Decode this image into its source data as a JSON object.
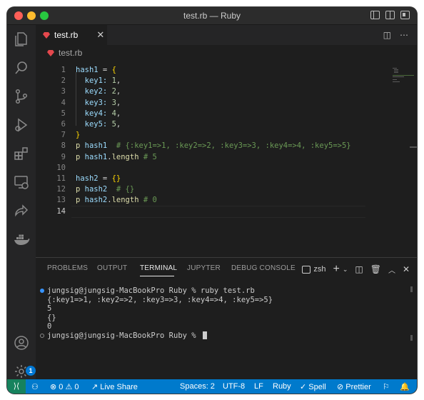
{
  "window": {
    "title": "test.rb — Ruby"
  },
  "tab": {
    "label": "test.rb"
  },
  "breadcrumb": {
    "label": "test.rb"
  },
  "editor": {
    "line_numbers": [
      "1",
      "2",
      "3",
      "4",
      "5",
      "6",
      "7",
      "8",
      "9",
      "10",
      "11",
      "12",
      "13",
      "14"
    ],
    "lines": [
      [
        {
          "t": "hash1",
          "c": "var"
        },
        {
          "t": " = ",
          "c": "plain"
        },
        {
          "t": "{",
          "c": "brace"
        }
      ],
      [
        {
          "t": "  key1:",
          "c": "sym"
        },
        {
          "t": " ",
          "c": "plain"
        },
        {
          "t": "1",
          "c": "num"
        },
        {
          "t": ",",
          "c": "plain"
        }
      ],
      [
        {
          "t": "  key2:",
          "c": "sym"
        },
        {
          "t": " ",
          "c": "plain"
        },
        {
          "t": "2",
          "c": "num"
        },
        {
          "t": ",",
          "c": "plain"
        }
      ],
      [
        {
          "t": "  key3:",
          "c": "sym"
        },
        {
          "t": " ",
          "c": "plain"
        },
        {
          "t": "3",
          "c": "num"
        },
        {
          "t": ",",
          "c": "plain"
        }
      ],
      [
        {
          "t": "  key4:",
          "c": "sym"
        },
        {
          "t": " ",
          "c": "plain"
        },
        {
          "t": "4",
          "c": "num"
        },
        {
          "t": ",",
          "c": "plain"
        }
      ],
      [
        {
          "t": "  key5:",
          "c": "sym"
        },
        {
          "t": " ",
          "c": "plain"
        },
        {
          "t": "5",
          "c": "num"
        },
        {
          "t": ",",
          "c": "plain"
        }
      ],
      [
        {
          "t": "}",
          "c": "brace"
        }
      ],
      [
        {
          "t": "p",
          "c": "kw"
        },
        {
          "t": " hash1",
          "c": "var"
        },
        {
          "t": "  # {:key1=>1, :key2=>2, :key3=>3, :key4=>4, :key5=>5}",
          "c": "comment"
        }
      ],
      [
        {
          "t": "p",
          "c": "kw"
        },
        {
          "t": " hash1",
          "c": "var"
        },
        {
          "t": ".",
          "c": "plain"
        },
        {
          "t": "length",
          "c": "kw"
        },
        {
          "t": " # 5",
          "c": "comment"
        }
      ],
      [],
      [
        {
          "t": "hash2",
          "c": "var"
        },
        {
          "t": " = ",
          "c": "plain"
        },
        {
          "t": "{}",
          "c": "brace"
        }
      ],
      [
        {
          "t": "p",
          "c": "kw"
        },
        {
          "t": " hash2",
          "c": "var"
        },
        {
          "t": "  # {}",
          "c": "comment"
        }
      ],
      [
        {
          "t": "p",
          "c": "kw"
        },
        {
          "t": " hash2",
          "c": "var"
        },
        {
          "t": ".",
          "c": "plain"
        },
        {
          "t": "length",
          "c": "kw"
        },
        {
          "t": " # 0",
          "c": "comment"
        }
      ],
      []
    ]
  },
  "panel": {
    "tabs": [
      "PROBLEMS",
      "OUTPUT",
      "TERMINAL",
      "JUPYTER",
      "DEBUG CONSOLE"
    ],
    "active_tab": "TERMINAL",
    "shell": "zsh",
    "terminal_lines": [
      "jungsig@jungsig-MacBookPro Ruby % ruby test.rb",
      "{:key1=>1, :key2=>2, :key3=>3, :key4=>4, :key5=>5}",
      "5",
      "{}",
      "0",
      "jungsig@jungsig-MacBookPro Ruby % "
    ]
  },
  "status": {
    "errors": "0",
    "warnings": "0",
    "live_share": "Live Share",
    "spaces": "Spaces: 2",
    "encoding": "UTF-8",
    "eol": "LF",
    "language": "Ruby",
    "spell": "Spell",
    "prettier": "Prettier"
  },
  "accounts": {
    "badge": "1"
  },
  "colors": {
    "statusbar": "#007acc",
    "remote": "#16825d",
    "ruby": "#e5484d"
  },
  "icons": {
    "activity": [
      "explorer-icon",
      "search-icon",
      "source-control-icon",
      "run-debug-icon",
      "extensions-icon",
      "remote-explorer-icon",
      "live-share-icon",
      "docker-icon",
      "accounts-icon",
      "manage-gear-icon"
    ]
  }
}
